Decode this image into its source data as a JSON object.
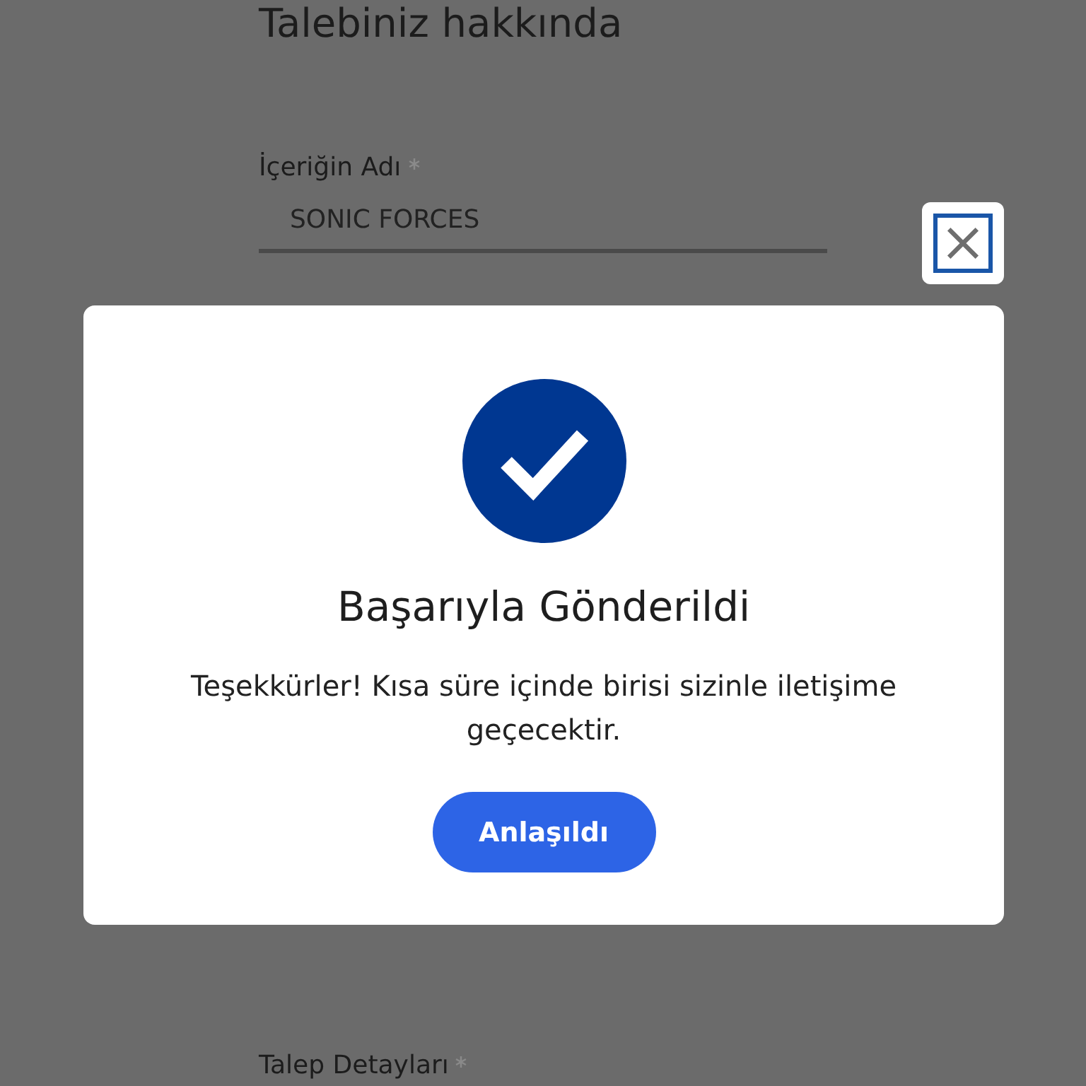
{
  "form": {
    "heading": "Talebiniz hakkında",
    "fields": [
      {
        "label": "İçeriğin Adı",
        "required": true,
        "value": "SONIC FORCES"
      },
      {
        "label": "Talep Detayları",
        "required": true
      }
    ]
  },
  "dialog": {
    "title": "Başarıyla Gönderildi",
    "message": "Teşekkürler! Kısa süre içinde birisi sizinle iletişime geçecektir.",
    "button": "Anlaşıldı"
  }
}
